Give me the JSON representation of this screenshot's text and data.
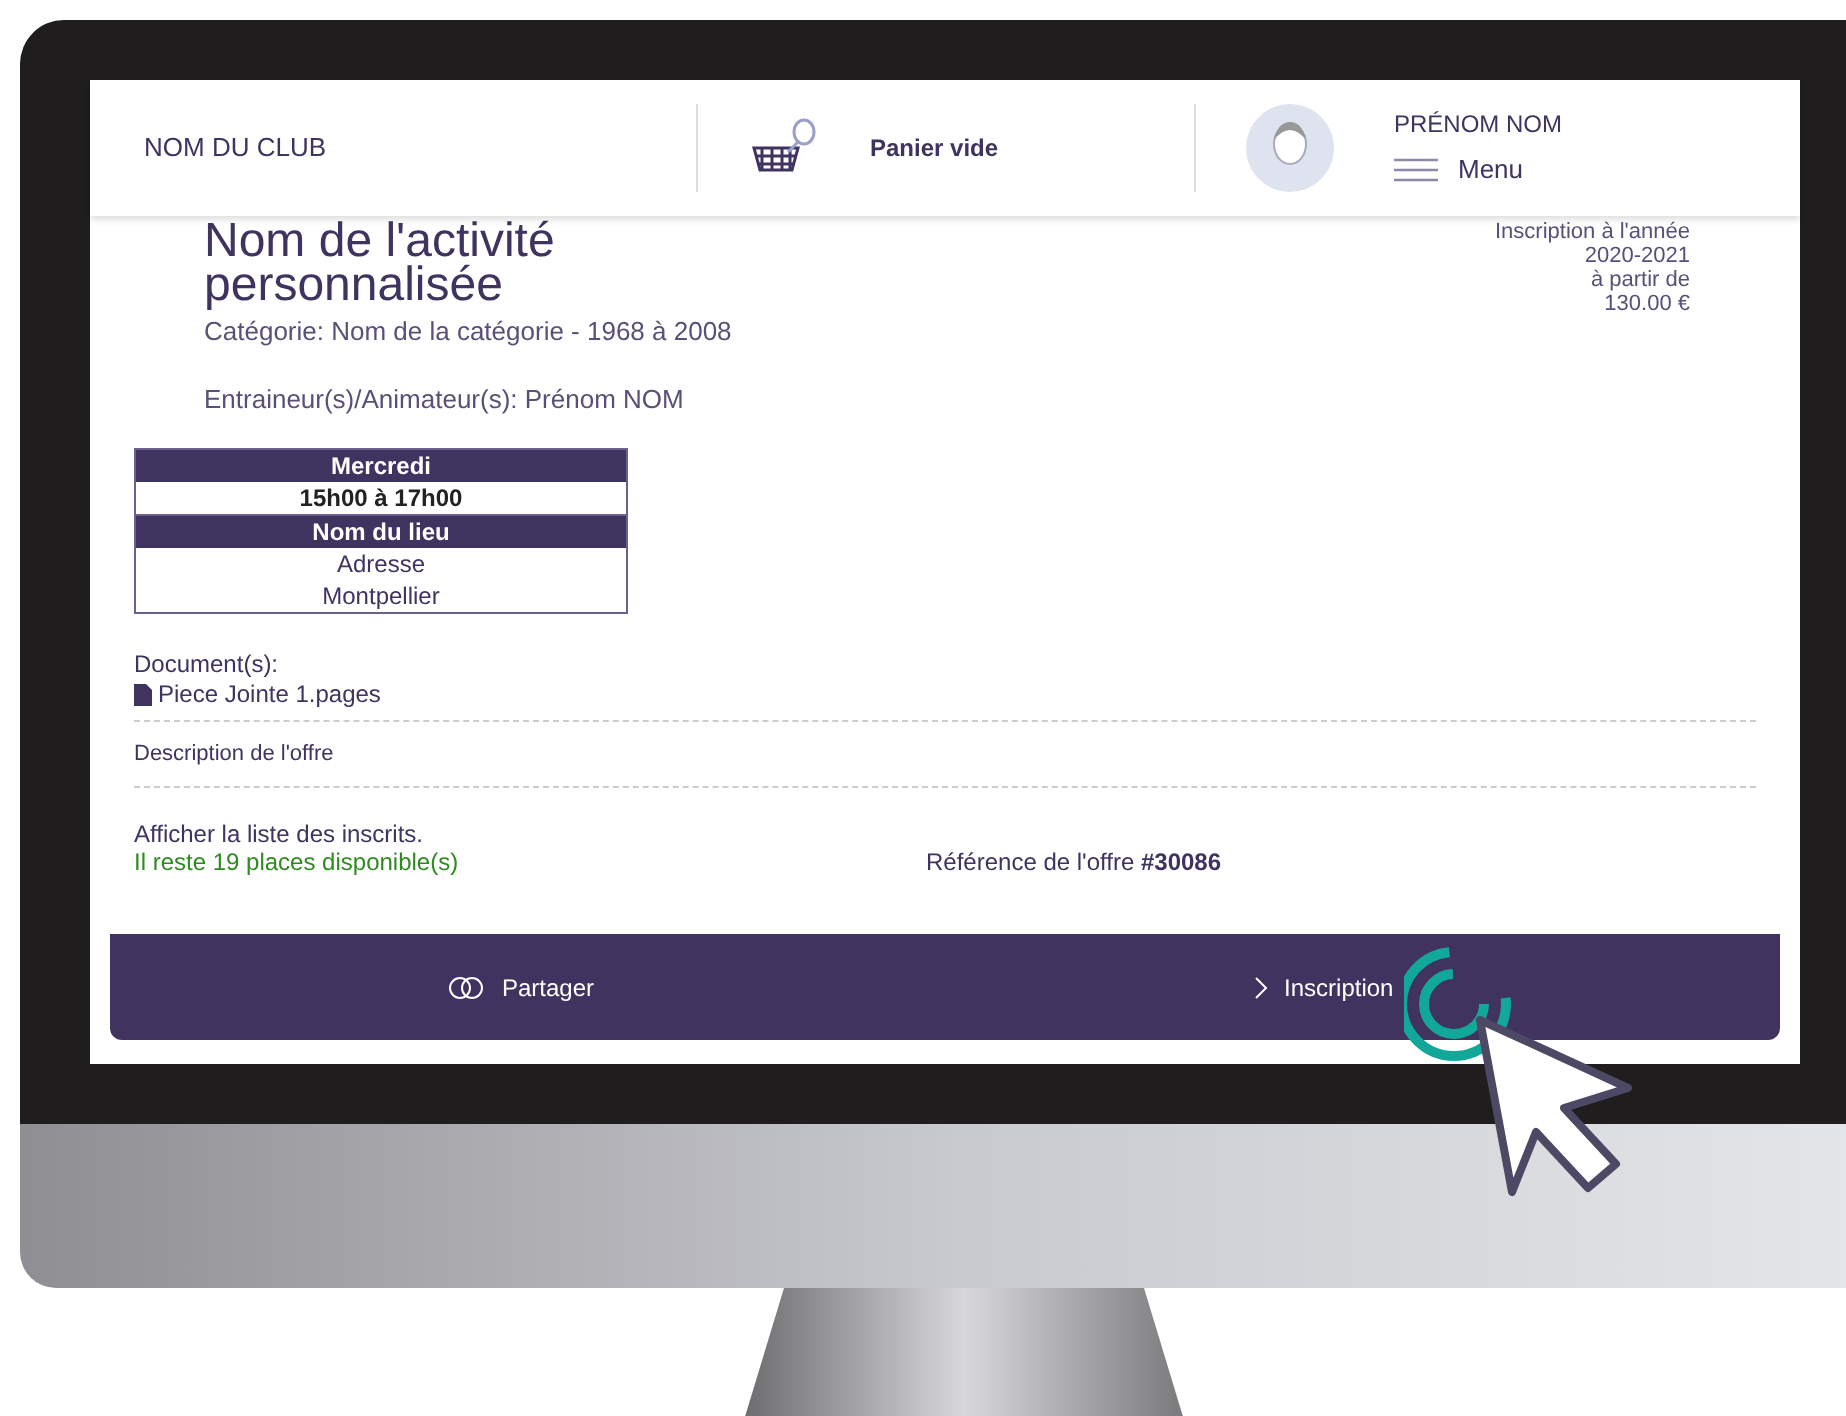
{
  "header": {
    "club": "NOM DU CLUB",
    "cart": "Panier vide",
    "user": "PRÉNOM NOM",
    "menu": "Menu"
  },
  "activity": {
    "title": "Nom de l'activité personnalisée",
    "category": "Catégorie: Nom de la catégorie - 1968 à 2008",
    "trainers": "Entraineur(s)/Animateur(s): Prénom NOM"
  },
  "price": [
    "Inscription à l'année",
    "2020-2021",
    "à partir de",
    "130.00 €"
  ],
  "schedule": [
    {
      "text": "Mercredi",
      "kind": "heading"
    },
    {
      "text": "15h00 à 17h00",
      "kind": "time"
    },
    {
      "text": "Nom du lieu",
      "kind": "heading"
    },
    {
      "text": "Adresse",
      "kind": "line"
    },
    {
      "text": "Montpellier",
      "kind": "line"
    }
  ],
  "documents": {
    "label": "Document(s):",
    "files": [
      "Piece Jointe 1.pages"
    ]
  },
  "description": "Description de l'offre",
  "registrants_link": "Afficher la liste des inscrits.",
  "availability": "Il reste 19 places disponible(s)",
  "reference": "Référence de l'offre **#30086**",
  "footer": {
    "share": "Partager",
    "register": "Inscription"
  }
}
